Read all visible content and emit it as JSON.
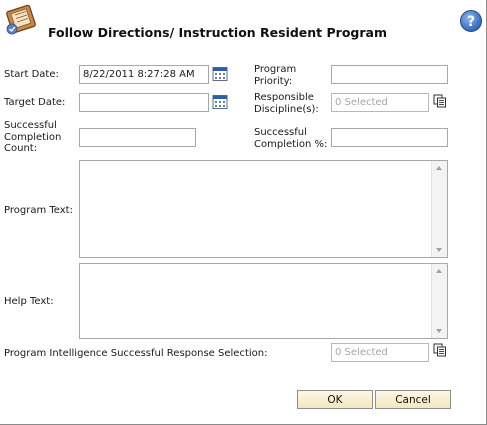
{
  "header": {
    "title": "Follow Directions/ Instruction Resident Program",
    "program_icon": "program-book-icon",
    "help_icon": "help-question-icon"
  },
  "form": {
    "start_date": {
      "label": "Start Date:",
      "value": "8/22/2011 8:27:28 AM",
      "icon": "calendar-icon"
    },
    "target_date": {
      "label": "Target Date:",
      "value": "",
      "icon": "calendar-icon"
    },
    "successful_completion_count": {
      "label_lines": [
        "Successful",
        "Completion",
        "Count:"
      ],
      "value": ""
    },
    "program_priority": {
      "label_lines": [
        "Program",
        "Priority:"
      ],
      "value": ""
    },
    "responsible_disciplines": {
      "label_lines": [
        "Responsible",
        "Discipline(s):"
      ],
      "value": "0 Selected",
      "icon": "multi-select-icon"
    },
    "successful_completion_pct": {
      "label_lines": [
        "Successful",
        "Completion %:"
      ],
      "value": ""
    },
    "program_text": {
      "label": "Program Text:",
      "value": ""
    },
    "help_text": {
      "label": "Help Text:",
      "value": ""
    },
    "pi_response_selection": {
      "label": "Program Intelligence Successful Response Selection:",
      "value": "0 Selected",
      "icon": "multi-select-icon"
    }
  },
  "buttons": {
    "ok": "OK",
    "cancel": "Cancel"
  },
  "colors": {
    "button_top": "#fdf8e6",
    "button_bottom": "#f2e7bd",
    "help_blue": "#2f64b8",
    "calendar_blue": "#2b5fae"
  }
}
